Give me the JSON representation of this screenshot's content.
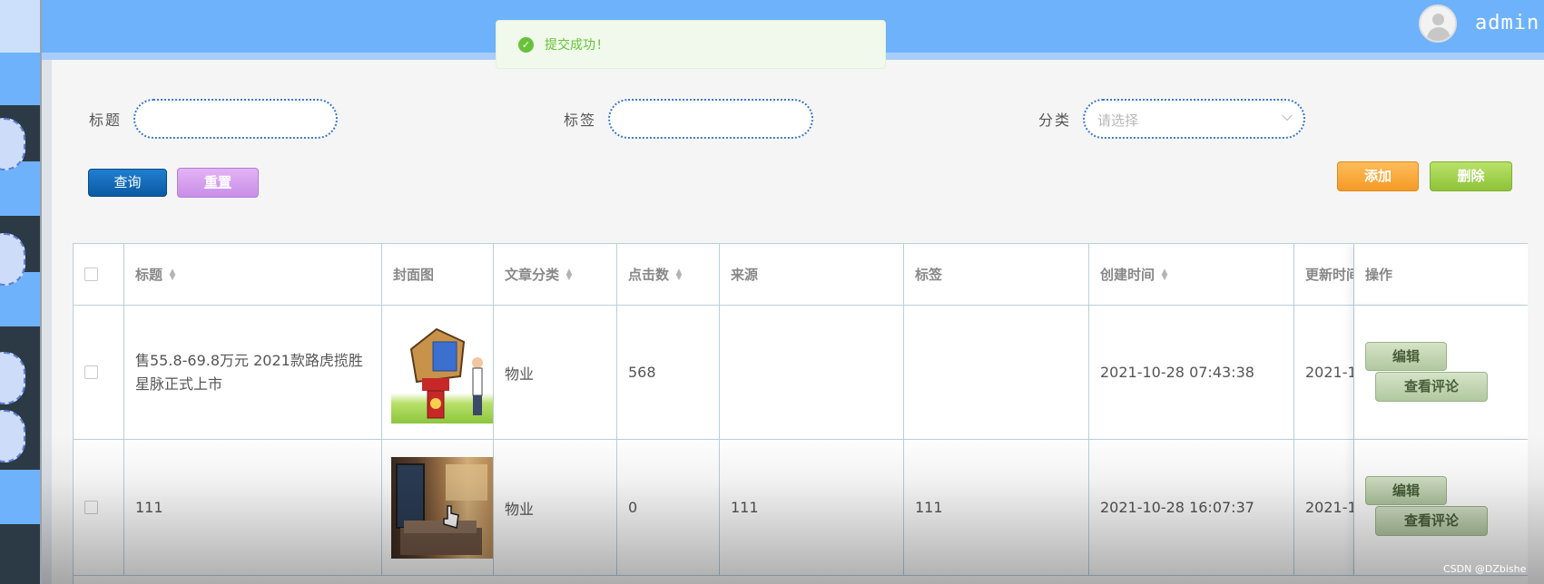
{
  "header": {
    "username": "admin"
  },
  "toast": {
    "message": "提交成功!"
  },
  "search": {
    "title_label": "标题",
    "tag_label": "标签",
    "category_label": "分类",
    "category_placeholder": "请选择",
    "query_button": "查询",
    "reset_button": "重置",
    "add_button": "添加",
    "delete_button": "删除"
  },
  "table": {
    "headers": {
      "title": "标题",
      "cover": "封面图",
      "category": "文章分类",
      "clicks": "点击数",
      "source": "来源",
      "tags": "标签",
      "created": "创建时间",
      "updated": "更新时间",
      "actions": "操作"
    },
    "rows": [
      {
        "title": "售55.8-69.8万元 2021款路虎揽胜星脉正式上市",
        "category": "物业",
        "clicks": "568",
        "source": "",
        "tags": "",
        "created": "2021-10-28 07:43:38",
        "updated": "2021-1",
        "edit": "编辑",
        "comments": "查看评论"
      },
      {
        "title": "111",
        "category": "物业",
        "clicks": "0",
        "source": "111",
        "tags": "111",
        "created": "2021-10-28 16:07:37",
        "updated": "2021-1",
        "edit": "编辑",
        "comments": "查看评论"
      }
    ]
  },
  "watermark": "CSDN @DZbishe",
  "colors": {
    "header": "#6eb2fc",
    "success": "#67c23a",
    "query": "#0b5aa3",
    "reset": "#c98ee8",
    "add": "#f49a25",
    "delete": "#8fc33a"
  }
}
